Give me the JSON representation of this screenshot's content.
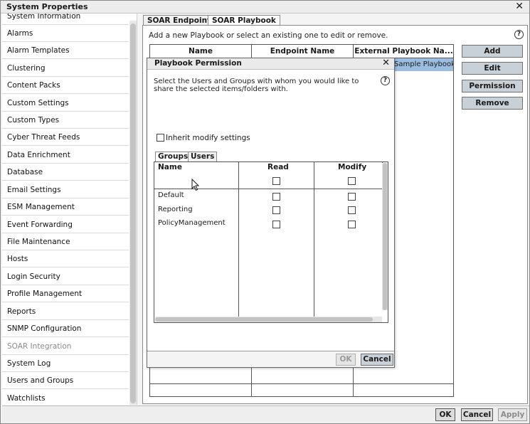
{
  "window": {
    "title": "System Properties",
    "close_glyph": "✕"
  },
  "sidebar": {
    "items": [
      {
        "label": "System Information",
        "disabled": false
      },
      {
        "label": "Alarms",
        "disabled": false
      },
      {
        "label": "Alarm Templates",
        "disabled": false
      },
      {
        "label": "Clustering",
        "disabled": false
      },
      {
        "label": "Content Packs",
        "disabled": false
      },
      {
        "label": "Custom Settings",
        "disabled": false
      },
      {
        "label": "Custom Types",
        "disabled": false
      },
      {
        "label": "Cyber Threat Feeds",
        "disabled": false
      },
      {
        "label": "Data Enrichment",
        "disabled": false
      },
      {
        "label": "Database",
        "disabled": false
      },
      {
        "label": "Email Settings",
        "disabled": false
      },
      {
        "label": "ESM Management",
        "disabled": false
      },
      {
        "label": "Event Forwarding",
        "disabled": false
      },
      {
        "label": "File Maintenance",
        "disabled": false
      },
      {
        "label": "Hosts",
        "disabled": false
      },
      {
        "label": "Login Security",
        "disabled": false
      },
      {
        "label": "Profile Management",
        "disabled": false
      },
      {
        "label": "Reports",
        "disabled": false
      },
      {
        "label": "SNMP Configuration",
        "disabled": false
      },
      {
        "label": "SOAR Integration",
        "disabled": true
      },
      {
        "label": "System Log",
        "disabled": false
      },
      {
        "label": "Users and Groups",
        "disabled": false
      },
      {
        "label": "Watchlists",
        "disabled": false
      }
    ]
  },
  "main": {
    "tabs": [
      {
        "label": "SOAR Endpoints",
        "active": false
      },
      {
        "label": "SOAR Playbook",
        "active": true
      }
    ],
    "instruction": "Add a new Playbook or select an existing one to edit or remove.",
    "help_glyph": "?",
    "table": {
      "columns": [
        "Name",
        "Endpoint Name",
        "External Playbook Na..."
      ],
      "selected_cell": "Sample Playbook"
    },
    "buttons": {
      "add": "Add",
      "edit": "Edit",
      "permission": "Permission",
      "remove": "Remove"
    }
  },
  "modal": {
    "title": "Playbook Permission",
    "close_glyph": "✕",
    "description": "Select the Users and Groups with whom you would like to share the selected items/folders with.",
    "help_glyph": "?",
    "inherit_label": "Inherit modify settings",
    "inherit_checked": false,
    "tabs": [
      {
        "label": "Groups",
        "active": true
      },
      {
        "label": "Users",
        "active": false
      }
    ],
    "columns": {
      "name": "Name",
      "read": "Read",
      "modify": "Modify"
    },
    "rows": [
      {
        "name": "Default",
        "read": false,
        "modify": false
      },
      {
        "name": "Reporting",
        "read": false,
        "modify": false
      },
      {
        "name": "PolicyManagement",
        "read": false,
        "modify": false
      }
    ],
    "buttons": {
      "ok": "OK",
      "cancel": "Cancel"
    },
    "ok_enabled": false
  },
  "footer": {
    "ok": "OK",
    "cancel": "Cancel",
    "apply": "Apply",
    "apply_enabled": false
  },
  "colors": {
    "selection": "#9bbde0",
    "action_button": "#c8d0d8"
  }
}
